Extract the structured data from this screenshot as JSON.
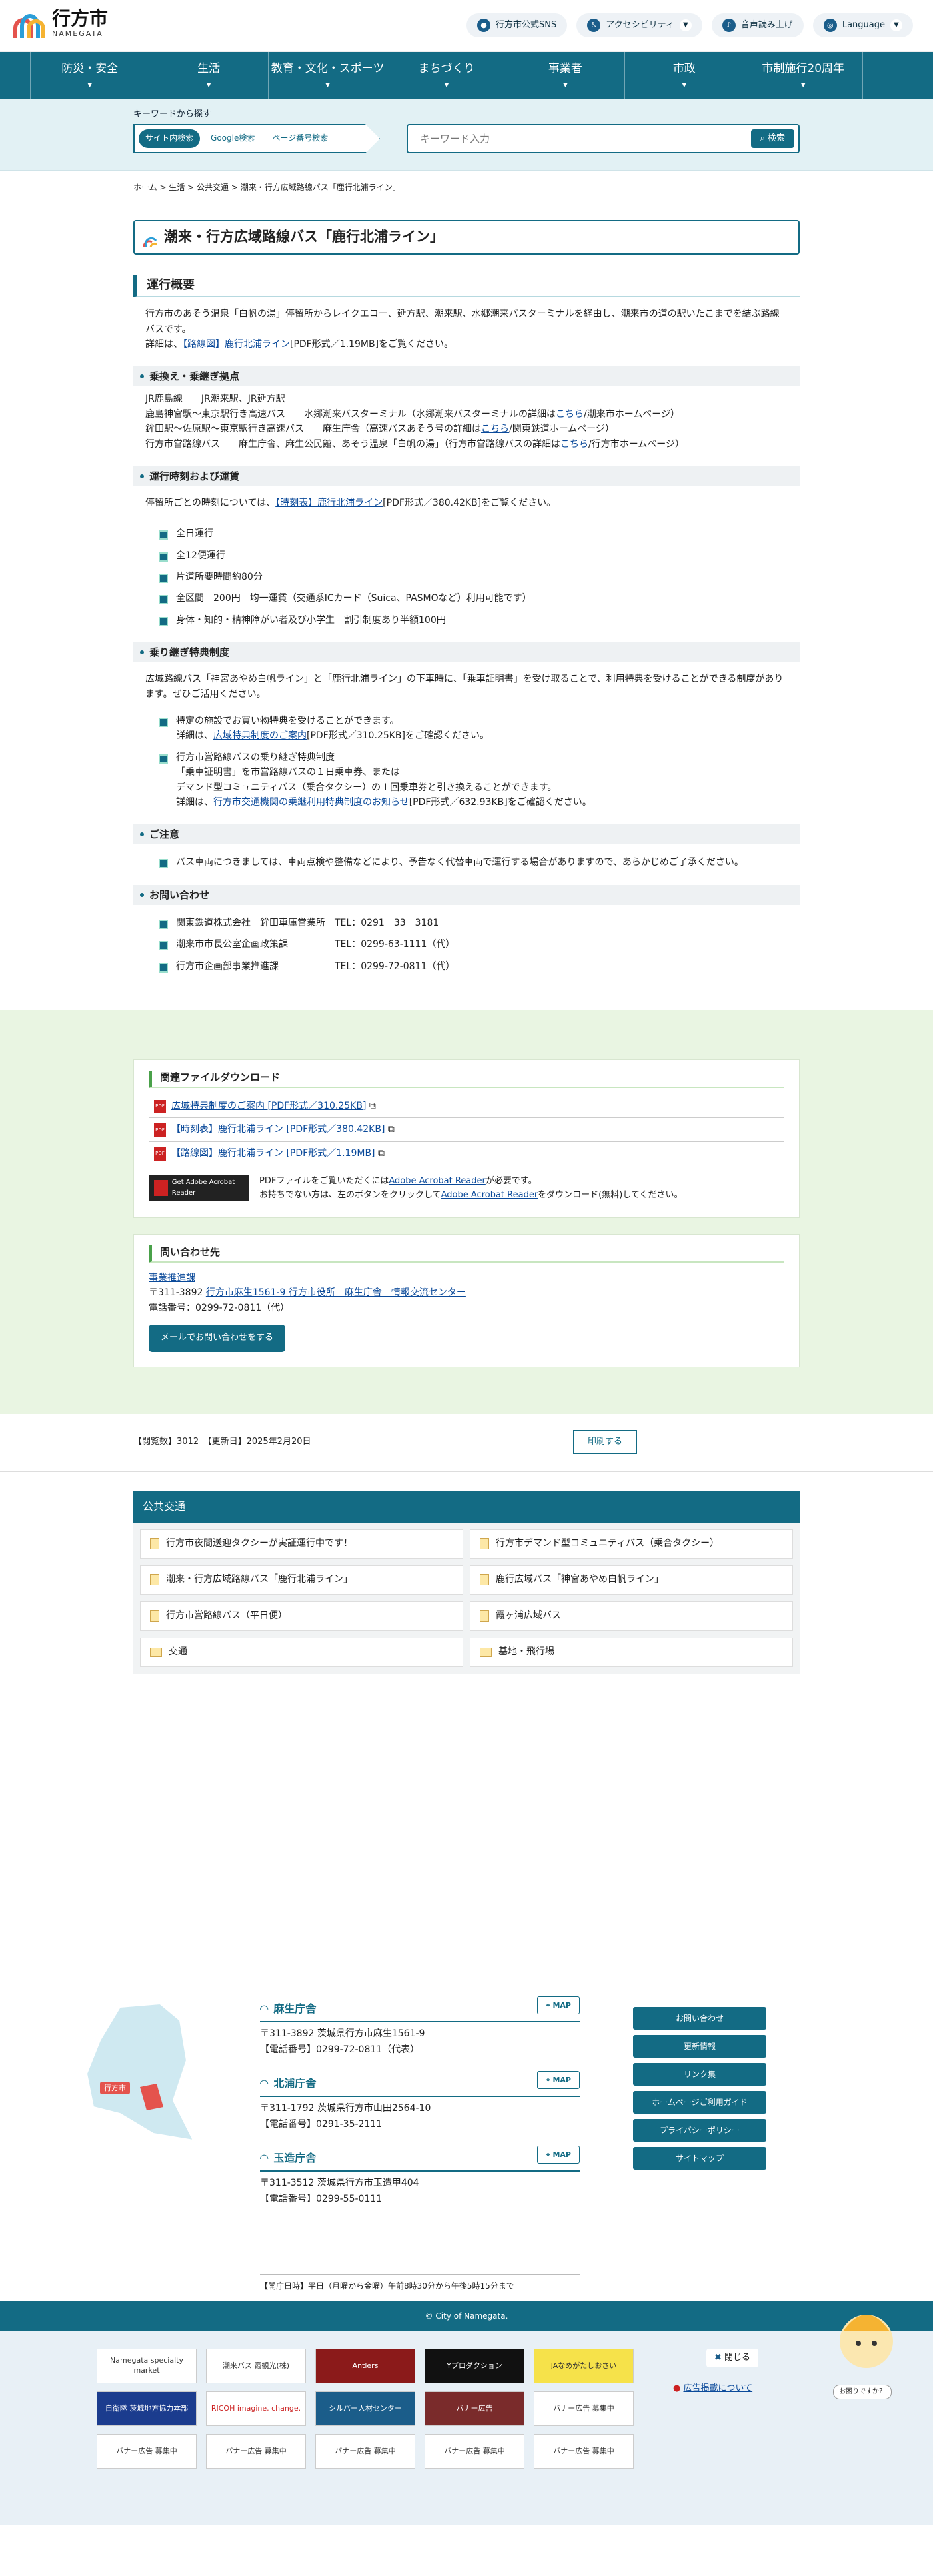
{
  "header": {
    "logo_jp": "行方市",
    "logo_en": "NAMEGATA",
    "buttons": [
      {
        "label": "行方市公式SNS",
        "icon": "sns-icon"
      },
      {
        "label": "アクセシビリティ",
        "icon": "accessibility-icon"
      },
      {
        "label": "音声読み上げ",
        "icon": "speaker-icon"
      },
      {
        "label": "Language",
        "icon": "globe-icon"
      }
    ]
  },
  "nav": [
    "防災・安全",
    "生活",
    "教育・文化・スポーツ",
    "まちづくり",
    "事業者",
    "市政",
    "市制施行20周年"
  ],
  "search": {
    "label": "キーワードから探す",
    "tabs": [
      "サイト内検索",
      "Google検索",
      "ページ番号検索"
    ],
    "placeholder": "キーワード入力",
    "button": "検索"
  },
  "breadcrumb": [
    "ホーム",
    "生活",
    "公共交通",
    "潮来・行方広域路線バス「鹿行北浦ライン」"
  ],
  "page_title": "潮来・行方広域路線バス「鹿行北浦ライン」",
  "s1": {
    "title": "運行概要",
    "text": "行方市のあそう温泉「白帆の湯」停留所からレイクエコー、延方駅、潮来駅、水郷潮来バスターミナルを経由し、潮来市の道の駅いたこまでを結ぶ路線バスです。",
    "detail_pre": "詳細は、",
    "link": "【路線図】鹿行北浦ライン",
    "detail_post": "[PDF形式／1.19MB]をご覧ください。"
  },
  "s2": {
    "title": "乗換え・乗継ぎ拠点",
    "l1": "JR鹿島線　　JR潮来駅、JR延方駅",
    "l2a": "鹿島神宮駅〜東京駅行き高速バス　　水郷潮来バスターミナル（水郷潮来バスターミナルの詳細は",
    "l2b": "こちら",
    "l2c": "/潮来市ホームページ）",
    "l3a": "鉾田駅〜佐原駅〜東京駅行き高速バス　　麻生庁舎（高速バスあそう号の詳細は",
    "l3b": "こちら",
    "l3c": "/関東鉄道ホームページ）",
    "l4a": "行方市営路線バス　　麻生庁舎、麻生公民館、あそう温泉「白帆の湯」（行方市営路線バスの詳細は",
    "l4b": "こちら",
    "l4c": "/行方市ホームページ）"
  },
  "s3": {
    "title": "運行時刻および運賃",
    "pre": "停留所ごとの時刻については、",
    "link": "【時刻表】鹿行北浦ライン",
    "post": "[PDF形式／380.42KB]をご覧ください。",
    "items": [
      "全日運行",
      "全12便運行",
      "片道所要時間約80分",
      "全区間　200円　均一運賃（交通系ICカード（Suica、PASMOなど）利用可能です）",
      "身体・知的・精神障がい者及び小学生　割引制度あり半額100円"
    ]
  },
  "s4": {
    "title": "乗り継ぎ特典制度",
    "text": "広域路線バス「神宮あやめ白帆ライン」と「鹿行北浦ライン」の下車時に、「乗車証明書」を受け取ることで、利用特典を受けることができる制度があります。ぜひご活用ください。",
    "i1": "特定の施設でお買い物特典を受けることができます。",
    "i1b": "詳細は、",
    "i1link": "広域特典制度のご案内",
    "i1c": "[PDF形式／310.25KB]をご確認ください。",
    "i2": "行方市営路線バスの乗り継ぎ特典制度",
    "i2b": "「乗車証明書」を市営路線バスの１日乗車券、または",
    "i2c": "デマンド型コミュニティバス（乗合タクシー）の１回乗車券と引き換えることができます。",
    "i2d": "詳細は、",
    "i2link": "行方市交通機関の乗継利用特典制度のお知らせ",
    "i2e": "[PDF形式／632.93KB]をご確認ください。"
  },
  "s5": {
    "title": "ご注意",
    "item": "バス車両につきましては、車両点検や整備などにより、予告なく代替車両で運行する場合がありますので、あらかじめご了承ください。"
  },
  "s6": {
    "title": "お問い合わせ",
    "items": [
      "関東鉄道株式会社　鉾田車庫営業所　TEL：0291－33－3181",
      "潮来市市長公室企画政策課　　　　　TEL：0299-63-1111（代）",
      "行方市企画部事業推進課　　　　　　TEL：0299-72-0811（代）"
    ]
  },
  "downloads": {
    "title": "関連ファイルダウンロード",
    "files": [
      "広域特典制度のご案内 [PDF形式／310.25KB]",
      "【時刻表】鹿行北浦ライン [PDF形式／380.42KB]",
      "【路線図】鹿行北浦ライン [PDF形式／1.19MB]"
    ],
    "acro_btn": "Get Adobe Acrobat Reader",
    "acro1a": "PDFファイルをご覧いただくには",
    "acro_link": "Adobe Acrobat Reader",
    "acro1b": "が必要です。",
    "acro2a": "お持ちでない方は、左のボタンをクリックして",
    "acro2b": "をダウンロード(無料)してください。"
  },
  "contact": {
    "title": "問い合わせ先",
    "dept": "事業推進課",
    "addr_pre": "〒311-3892 ",
    "addr_link": "行方市麻生1561-9 行方市役所　麻生庁舎　情報交流センター",
    "tel": "電話番号：0299-72-0811（代）",
    "mail": "メールでお問い合わせをする"
  },
  "meta": {
    "views": "【閲覧数】3012　【更新日】2025年2月20日",
    "print": "印刷する"
  },
  "related": {
    "title": "公共交通",
    "items": [
      "行方市夜間送迎タクシーが実証運行中です！",
      "行方市デマンド型コミュニティバス（乗合タクシー）",
      "潮来・行方広域路線バス「鹿行北浦ライン」",
      "鹿行広域バス「神宮あやめ白帆ライン」",
      "行方市営路線バス（平日便）",
      "霞ヶ浦広域バス",
      "交通",
      "基地・飛行場"
    ]
  },
  "footer": {
    "map_label": "行方市",
    "map_btn": "MAP",
    "offices": [
      {
        "name": "麻生庁舎",
        "a": "〒311-3892 茨城県行方市麻生1561-9",
        "t": "【電話番号】0299-72-0811（代表）"
      },
      {
        "name": "北浦庁舎",
        "a": "〒311-1792 茨城県行方市山田2564-10",
        "t": "【電話番号】0291-35-2111"
      },
      {
        "name": "玉造庁舎",
        "a": "〒311-3512 茨城県行方市玉造甲404",
        "t": "【電話番号】0299-55-0111"
      }
    ],
    "hours": "【開庁日時】平日（月曜から金曜）午前8時30分から午後5時15分まで",
    "links": [
      "お問い合わせ",
      "更新情報",
      "リンク集",
      "ホームページご利用ガイド",
      "プライバシーポリシー",
      "サイトマップ"
    ],
    "copyright": "© City of Namegata.",
    "banners": [
      "Namegata specialty market",
      "潮来バス 霞観光(株)",
      "Antlers",
      "Yプロダクション",
      "JAなめがたしおさい",
      "自衛隊 茨城地方協力本部",
      "RICOH imagine. change.",
      "シルバー人材センター",
      "バナー広告",
      "バナー広告 募集中",
      "バナー広告 募集中",
      "バナー広告 募集中",
      "バナー広告 募集中",
      "バナー広告 募集中",
      "バナー広告 募集中"
    ],
    "close": "閉じる",
    "adlink": "広告掲載について",
    "mascot": "お困りですか？"
  }
}
